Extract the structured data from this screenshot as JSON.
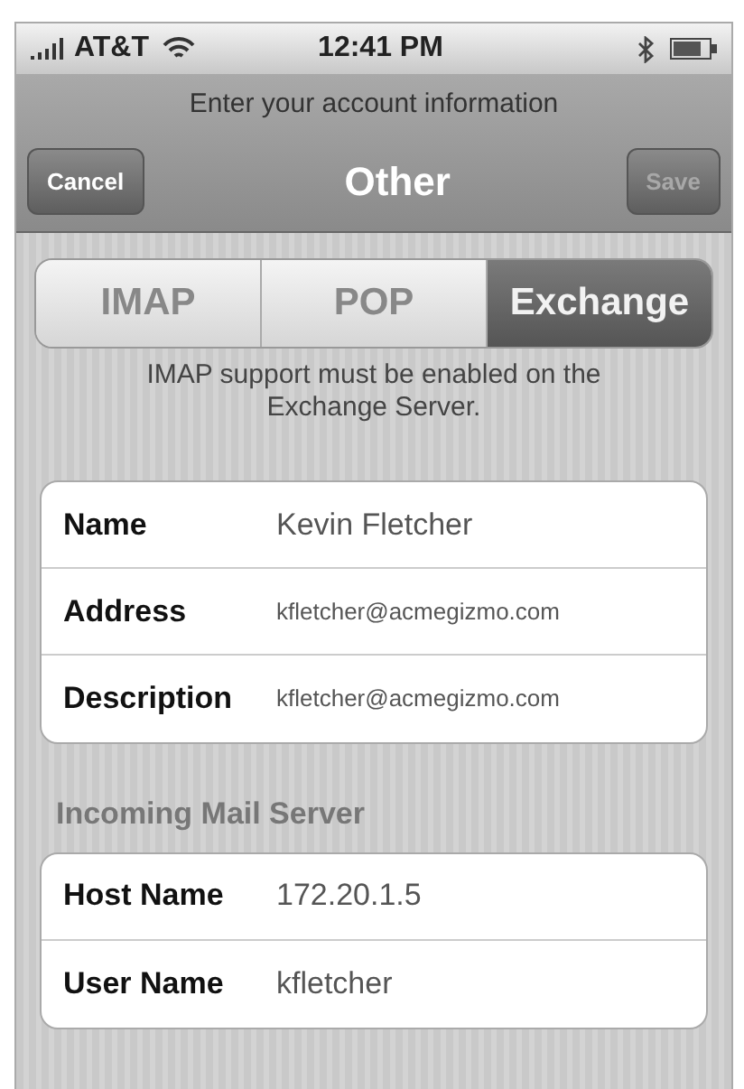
{
  "status_bar": {
    "carrier": "AT&T",
    "time": "12:41 PM"
  },
  "prompt": "Enter your account information",
  "nav_bar": {
    "title": "Other",
    "buttons": [
      {
        "label": "Cancel",
        "disabled": false
      },
      {
        "label": "Save",
        "disabled": true
      }
    ]
  },
  "tabs": [
    {
      "label": "IMAP",
      "selected": false
    },
    {
      "label": "POP",
      "selected": false
    },
    {
      "label": "Exchange",
      "selected": true
    }
  ],
  "note": "IMAP support must be enabled on the Exchange Server.",
  "sections": [
    {
      "fields": [
        {
          "label": "Name",
          "value": "Kevin Fletcher",
          "kind": "text"
        },
        {
          "label": "Address",
          "value": "kfletcher@acmegizmo.com",
          "kind": "email"
        },
        {
          "label": "Description",
          "value": "kfletcher@acmegizmo.com",
          "kind": "email"
        }
      ]
    },
    {
      "header": "Incoming Mail Server",
      "fields": [
        {
          "label": "Host Name",
          "value": "172.20.1.5",
          "kind": "text"
        },
        {
          "label": "User Name",
          "value": "kfletcher",
          "kind": "text"
        }
      ]
    }
  ]
}
